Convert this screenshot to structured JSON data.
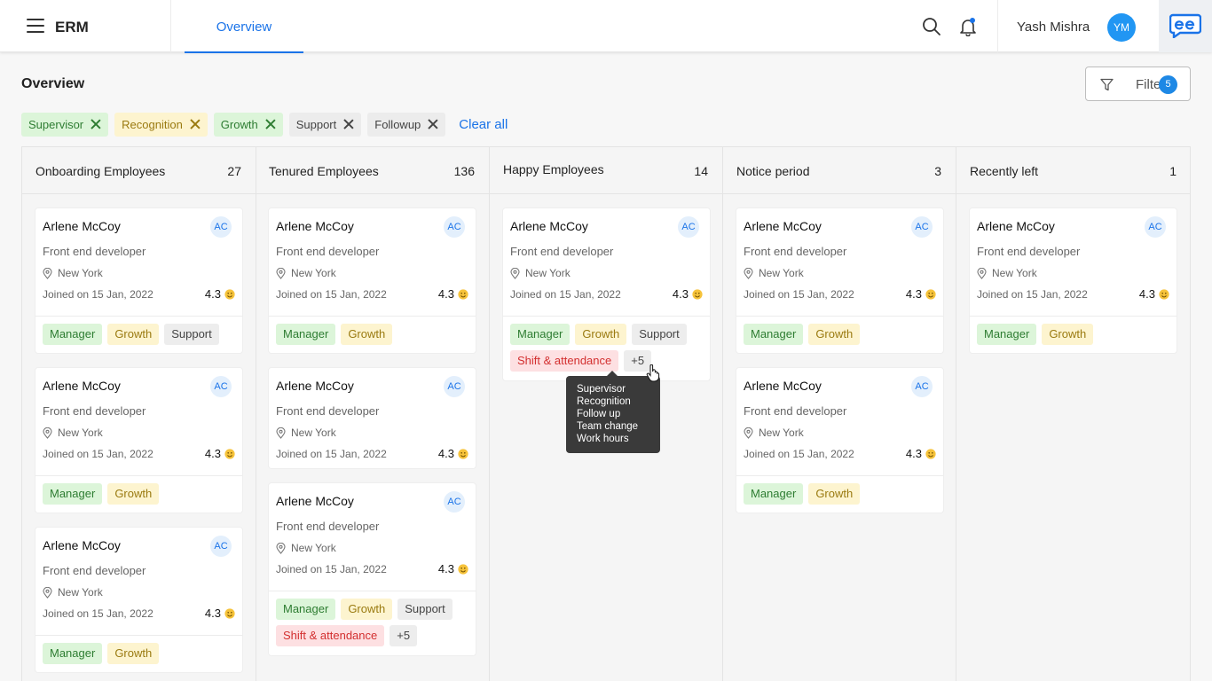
{
  "app": {
    "name": "ERM"
  },
  "nav": {
    "overview_tab": "Overview"
  },
  "user": {
    "name": "Yash Mishra",
    "initials": "YM"
  },
  "page": {
    "title": "Overview"
  },
  "filter": {
    "label": "Filter",
    "count": "5"
  },
  "chips": [
    {
      "label": "Supervisor",
      "style": "green"
    },
    {
      "label": "Recognition",
      "style": "yellow"
    },
    {
      "label": "Growth",
      "style": "green"
    },
    {
      "label": "Support",
      "style": "grey"
    },
    {
      "label": "Followup",
      "style": "grey"
    }
  ],
  "clear_all": "Clear all",
  "card_template": {
    "name": "Arlene McCoy",
    "initials": "AC",
    "role": "Front end developer",
    "location": "New York",
    "joined": "Joined on 15 Jan, 2022",
    "rating": "4.3"
  },
  "columns": [
    {
      "title": "Onboarding Employees",
      "count": "27",
      "cards": [
        {
          "tags": [
            [
              "Manager",
              "green"
            ],
            [
              "Growth",
              "yellow"
            ],
            [
              "Support",
              "grey"
            ]
          ]
        },
        {
          "tags": [
            [
              "Manager",
              "green"
            ],
            [
              "Growth",
              "yellow"
            ]
          ]
        },
        {
          "tags": [
            [
              "Manager",
              "green"
            ],
            [
              "Growth",
              "yellow"
            ]
          ]
        }
      ]
    },
    {
      "title": "Tenured Employees",
      "count": "136",
      "cards": [
        {
          "tags": [
            [
              "Manager",
              "green"
            ],
            [
              "Growth",
              "yellow"
            ]
          ]
        },
        {
          "tags": []
        },
        {
          "tags": [
            [
              "Manager",
              "green"
            ],
            [
              "Growth",
              "yellow"
            ],
            [
              "Support",
              "grey"
            ],
            [
              "Shift & attendance",
              "red"
            ],
            [
              "+5",
              "grey"
            ]
          ]
        }
      ]
    },
    {
      "title": "Happy Employees",
      "count": "14",
      "cards": [
        {
          "tags": [
            [
              "Manager",
              "green"
            ],
            [
              "Growth",
              "yellow"
            ],
            [
              "Support",
              "grey"
            ],
            [
              "Shift & attendance",
              "red"
            ],
            [
              "+5",
              "grey"
            ]
          ]
        }
      ]
    },
    {
      "title": "Notice period",
      "count": "3",
      "cards": [
        {
          "tags": [
            [
              "Manager",
              "green"
            ],
            [
              "Growth",
              "yellow"
            ]
          ]
        },
        {
          "tags": [
            [
              "Manager",
              "green"
            ],
            [
              "Growth",
              "yellow"
            ]
          ]
        }
      ]
    },
    {
      "title": "Recently left",
      "count": "1",
      "cards": [
        {
          "tags": [
            [
              "Manager",
              "green"
            ],
            [
              "Growth",
              "yellow"
            ]
          ]
        }
      ]
    }
  ],
  "tooltip": {
    "lines": [
      "Supervisor",
      "Recognition",
      "Follow up",
      "Team change",
      "Work hours"
    ]
  },
  "colors": {
    "accent": "#1a73e8",
    "avatar": "#2196f3"
  }
}
